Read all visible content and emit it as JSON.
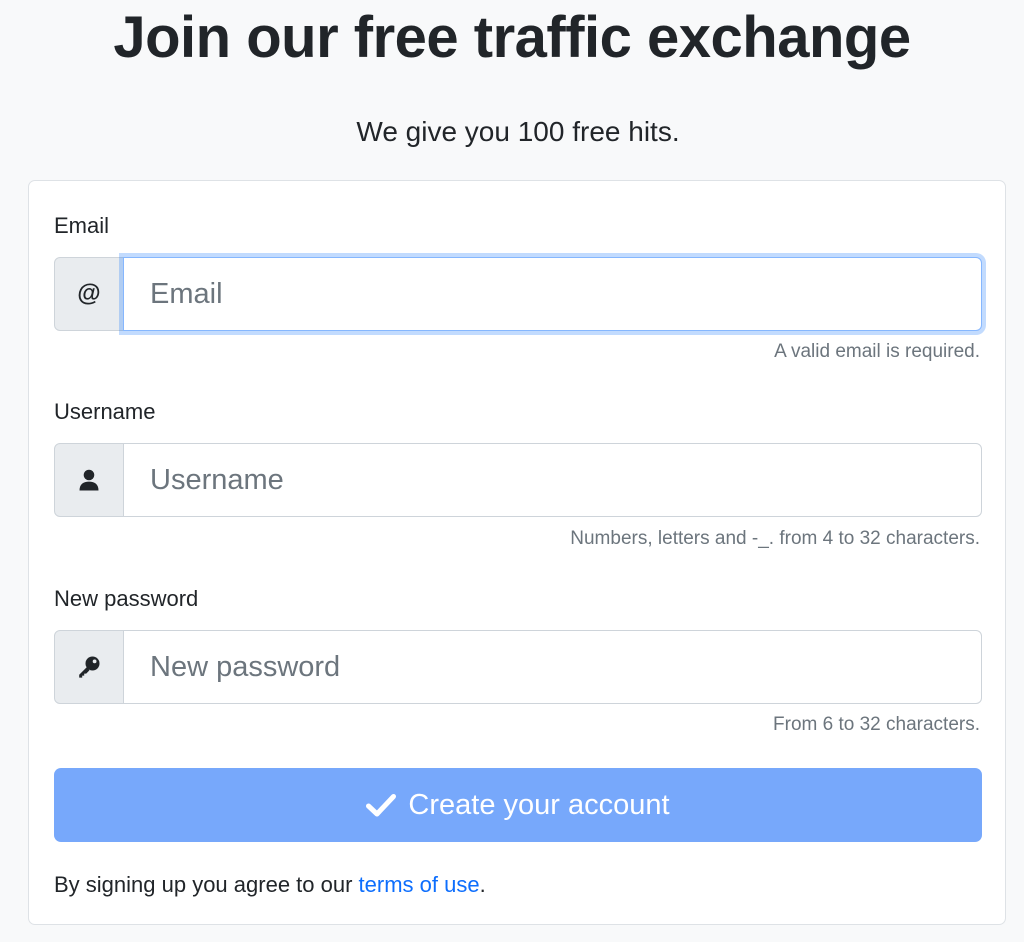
{
  "header": {
    "title": "Join our free traffic exchange",
    "subtitle": "We give you 100 free hits."
  },
  "form": {
    "email": {
      "label": "Email",
      "addon": "@",
      "placeholder": "Email",
      "help": "A valid email is required.",
      "icon": "at-icon"
    },
    "username": {
      "label": "Username",
      "placeholder": "Username",
      "help": "Numbers, letters and -_. from 4 to 32 characters.",
      "icon": "user-icon"
    },
    "password": {
      "label": "New password",
      "placeholder": "New password",
      "help": "From 6 to 32 characters.",
      "icon": "key-icon"
    },
    "submit": {
      "label": "Create your account",
      "icon": "check-icon"
    },
    "terms": {
      "prefix": "By signing up you agree to our",
      "link": "terms of use",
      "suffix": "."
    }
  },
  "colors": {
    "accent": "#0d6efd",
    "button": "#77a8fb",
    "background": "#f8f9fa",
    "muted_text": "#6c757d"
  }
}
